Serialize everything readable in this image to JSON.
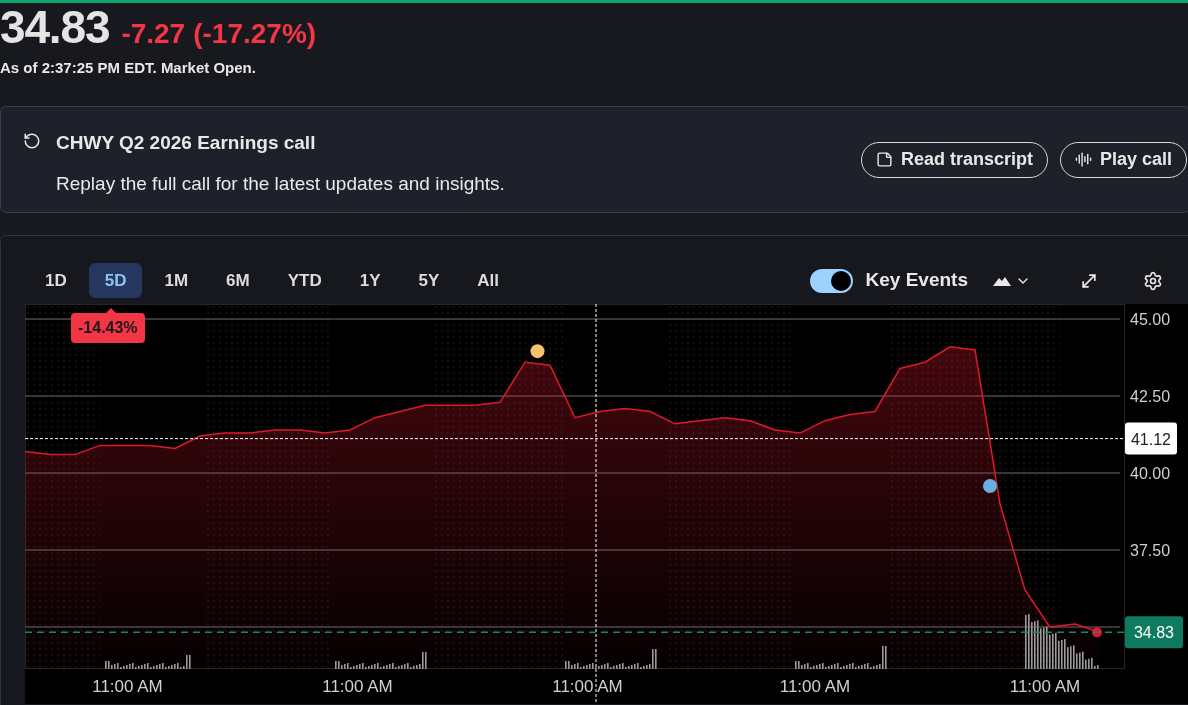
{
  "quote": {
    "price": "34.83",
    "change": "-7.27",
    "change_percent": "(-17.27%)",
    "as_of": "As of 2:37:25 PM EDT. Market Open."
  },
  "earnings_call": {
    "title": "CHWY Q2 2026 Earnings call",
    "subtitle": "Replay the full call for the latest updates and insights.",
    "buttons": [
      {
        "kind": "transcript",
        "label": "Read transcript"
      },
      {
        "kind": "play",
        "label": "Play call"
      }
    ]
  },
  "chart": {
    "ranges": [
      {
        "label": "1D",
        "selected": false
      },
      {
        "label": "5D",
        "selected": true
      },
      {
        "label": "1M",
        "selected": false
      },
      {
        "label": "6M",
        "selected": false
      },
      {
        "label": "YTD",
        "selected": false
      },
      {
        "label": "1Y",
        "selected": false
      },
      {
        "label": "5Y",
        "selected": false
      },
      {
        "label": "All",
        "selected": false
      }
    ],
    "period_change": "-14.43%",
    "x_axis_labels": [
      "11:00 AM",
      "11:00 AM",
      "11:00 AM",
      "11:00 AM",
      "11:00 AM"
    ],
    "key_events": {
      "label": "Key Events",
      "on": true,
      "markers": [
        {
          "color": "#f6c26b"
        },
        {
          "color": "#6ab0e4"
        }
      ]
    },
    "chart_data": {
      "type": "area",
      "grid": true,
      "ylim": [
        33.64,
        45.49
      ],
      "yticks": [
        {
          "value": 37.5,
          "label": "37.50"
        },
        {
          "value": 40,
          "label": "40.00"
        },
        {
          "value": 42.5,
          "label": "42.50"
        },
        {
          "value": 45,
          "label": "45.00"
        }
      ],
      "series": [
        {
          "color": "#e0182d",
          "values": [
            40.7,
            40.6,
            40.6,
            40.9,
            40.9,
            40.9,
            40.8,
            41.2,
            41.3,
            41.3,
            41.4,
            41.4,
            41.3,
            41.4,
            41.8,
            42.0,
            42.2,
            42.2,
            42.2,
            42.3,
            43.6,
            43.5,
            41.8,
            42.0,
            42.1,
            42.0,
            41.6,
            41.7,
            41.8,
            41.7,
            41.4,
            41.3,
            41.7,
            41.9,
            42.0,
            43.4,
            43.6,
            44.1,
            44.0,
            39.0,
            36.2,
            35.0,
            35.1,
            34.83
          ]
        }
      ]
    },
    "price_tags": [
      {
        "kind": "previous_close",
        "label": "41.12"
      },
      {
        "kind": "current",
        "label": "34.83"
      }
    ]
  }
}
